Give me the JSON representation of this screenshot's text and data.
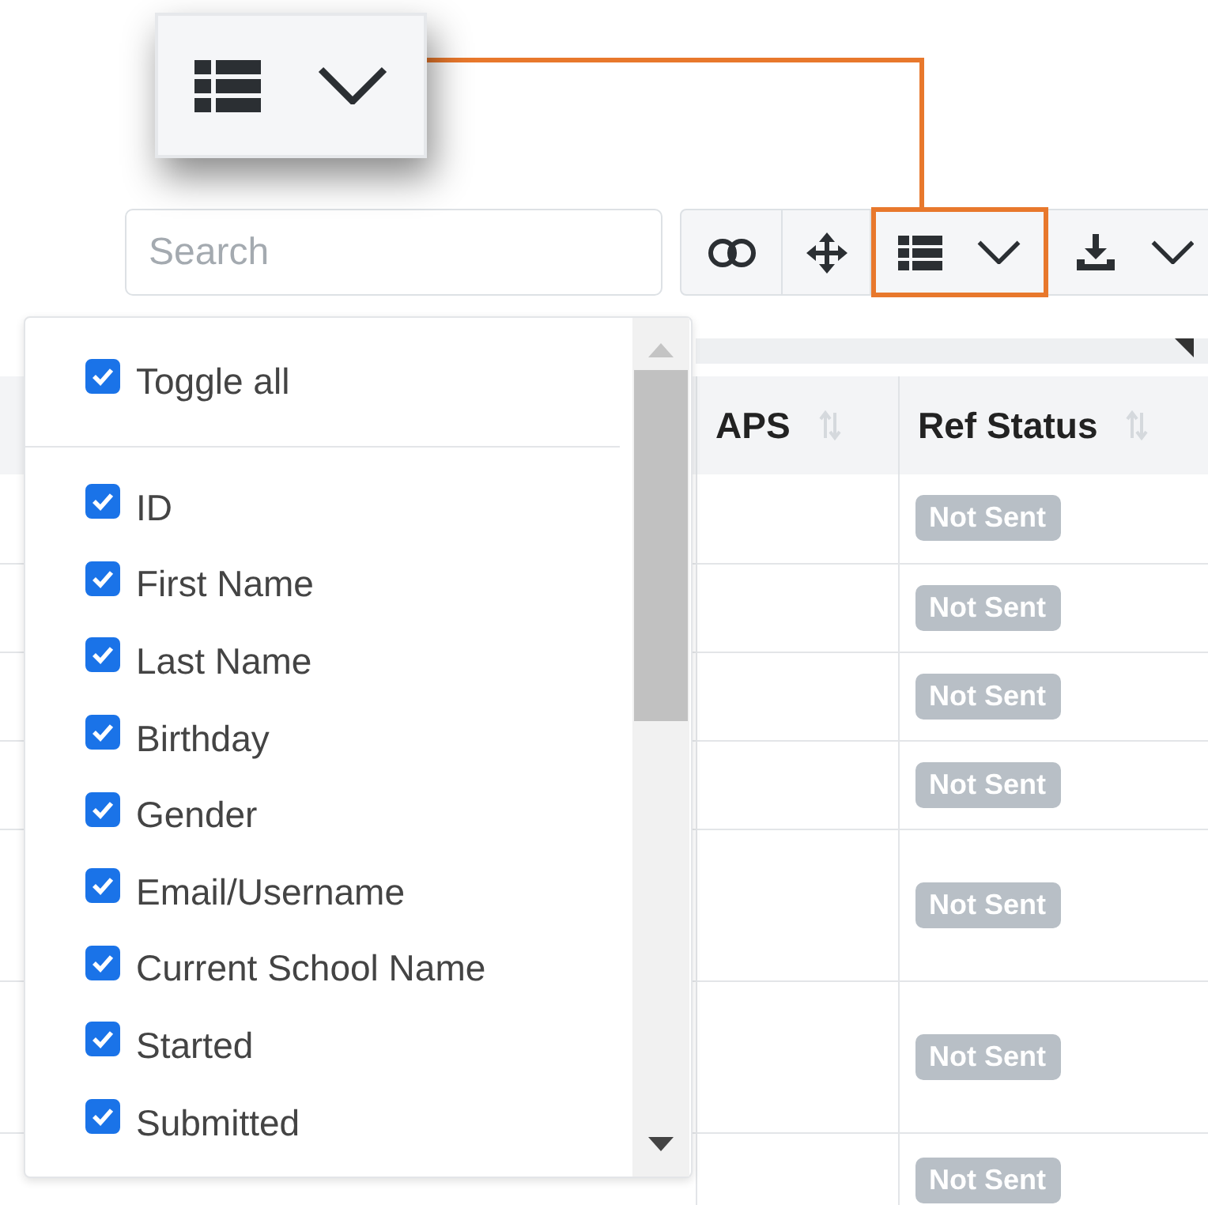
{
  "toolbar": {
    "search": {
      "placeholder": "Search"
    },
    "buttons": [
      {
        "kind": "toggle",
        "highlighted": false
      },
      {
        "kind": "move",
        "highlighted": false
      },
      {
        "kind": "columns",
        "highlighted": true
      },
      {
        "kind": "export",
        "highlighted": false
      }
    ]
  },
  "callout": {
    "kind": "columns"
  },
  "table": {
    "columns": [
      "APS",
      "Ref Status"
    ],
    "rows": [
      {
        "aps": "",
        "ref_status": "Not Sent"
      },
      {
        "aps": "",
        "ref_status": "Not Sent"
      },
      {
        "aps": "",
        "ref_status": "Not Sent"
      },
      {
        "aps": "",
        "ref_status": "Not Sent"
      },
      {
        "aps": "",
        "ref_status": "Not Sent"
      },
      {
        "aps": "",
        "ref_status": "Not Sent"
      },
      {
        "aps": "",
        "ref_status": "Not Sent"
      }
    ]
  },
  "column_menu": {
    "toggle_all": {
      "label": "Toggle all",
      "checked": true
    },
    "items": [
      {
        "label": "ID",
        "checked": true
      },
      {
        "label": "First Name",
        "checked": true
      },
      {
        "label": "Last Name",
        "checked": true
      },
      {
        "label": "Birthday",
        "checked": true
      },
      {
        "label": "Gender",
        "checked": true
      },
      {
        "label": "Email/Username",
        "checked": true
      },
      {
        "label": "Current School Name",
        "checked": true
      },
      {
        "label": "Started",
        "checked": true
      },
      {
        "label": "Submitted",
        "checked": true
      }
    ]
  }
}
